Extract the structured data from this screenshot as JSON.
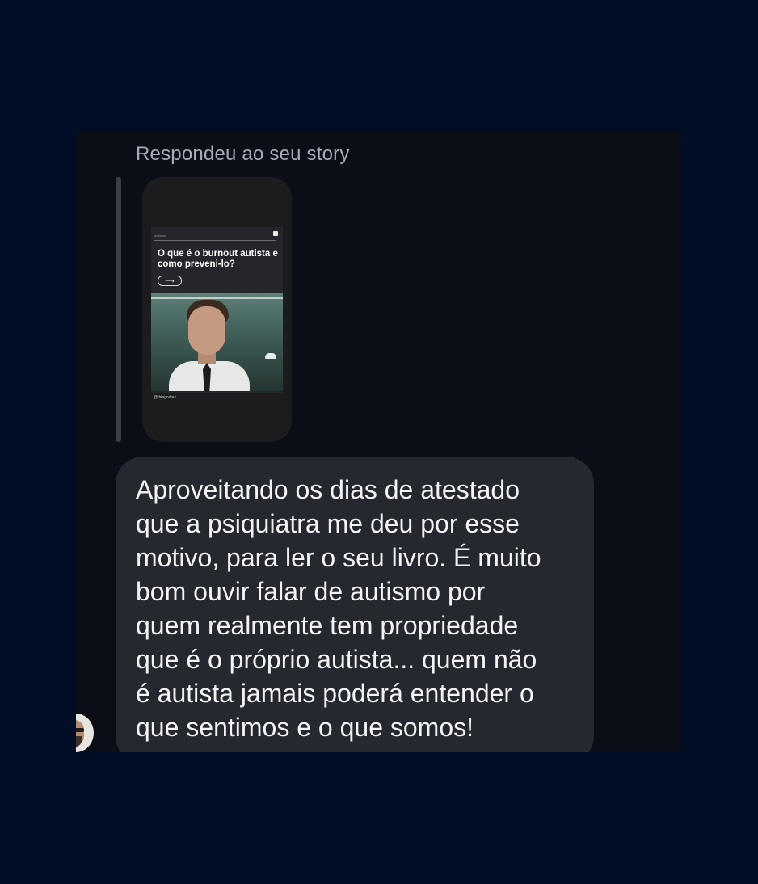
{
  "reply": {
    "label": "Respondeu ao seu story"
  },
  "story": {
    "tiny_top_text": "autismo",
    "headline": "O que é o burnout autista e como preveni-lo?",
    "arrow": "⟶",
    "handle": "@thiagodias"
  },
  "message": {
    "text": "Aproveitando os dias de atestado\nque a psiquiatra me deu por esse\nmotivo, para ler o seu livro. É muito\nbom ouvir falar de autismo por\nquem realmente tem propriedade\nque é o próprio autista... quem não\né autista jamais poderá entender o\nque sentimos e o que somos!"
  },
  "colors": {
    "page_bg": "#020d26",
    "panel_bg": "#0b0e16",
    "bubble_bg": "#25282e",
    "text": "#f2f3f5",
    "muted_text": "#a6abb6"
  }
}
